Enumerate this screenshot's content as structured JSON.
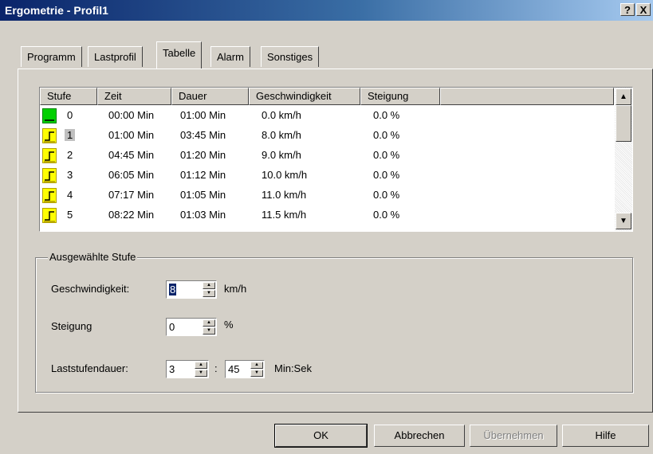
{
  "window": {
    "title": "Ergometrie - Profil1",
    "help_btn": "?",
    "close_btn": "X"
  },
  "tabs": [
    "Programm",
    "Lastprofil",
    "Tabelle",
    "Alarm",
    "Sonstiges"
  ],
  "table": {
    "columns": [
      "Stufe",
      "Zeit",
      "Dauer",
      "Geschwindigkeit",
      "Steigung"
    ],
    "rows": [
      {
        "icon": "green-level-icon",
        "stufe": "0",
        "zeit": "00:00 Min",
        "dauer": "01:00 Min",
        "speed": "0.0 km/h",
        "slope": "0.0 %"
      },
      {
        "icon": "yellow-step-icon",
        "stufe": "1",
        "zeit": "01:00 Min",
        "dauer": "03:45 Min",
        "speed": "8.0 km/h",
        "slope": "0.0 %"
      },
      {
        "icon": "yellow-step-icon",
        "stufe": "2",
        "zeit": "04:45 Min",
        "dauer": "01:20 Min",
        "speed": "9.0 km/h",
        "slope": "0.0 %"
      },
      {
        "icon": "yellow-step-icon",
        "stufe": "3",
        "zeit": "06:05 Min",
        "dauer": "01:12 Min",
        "speed": "10.0 km/h",
        "slope": "0.0 %"
      },
      {
        "icon": "yellow-step-icon",
        "stufe": "4",
        "zeit": "07:17 Min",
        "dauer": "01:05 Min",
        "speed": "11.0 km/h",
        "slope": "0.0 %"
      },
      {
        "icon": "yellow-step-icon",
        "stufe": "5",
        "zeit": "08:22 Min",
        "dauer": "01:03 Min",
        "speed": "11.5 km/h",
        "slope": "0.0 %"
      }
    ]
  },
  "selected_level": {
    "legend": "Ausgewählte Stufe",
    "speed_label": "Geschwindigkeit:",
    "speed_value": "8",
    "speed_unit": "km/h",
    "slope_label": "Steigung",
    "slope_value": "0",
    "slope_unit": "%",
    "duration_label": "Laststufendauer:",
    "duration_min": "3",
    "duration_sep": ":",
    "duration_sec": "45",
    "duration_unit": "Min:Sek"
  },
  "buttons": {
    "ok": "OK",
    "cancel": "Abbrechen",
    "apply": "Übernehmen",
    "help": "Hilfe"
  },
  "colors": {
    "titlebar": "#0a246a",
    "face": "#d4d0c8",
    "level_green": "#00d000",
    "step_yellow": "#ffff00"
  }
}
